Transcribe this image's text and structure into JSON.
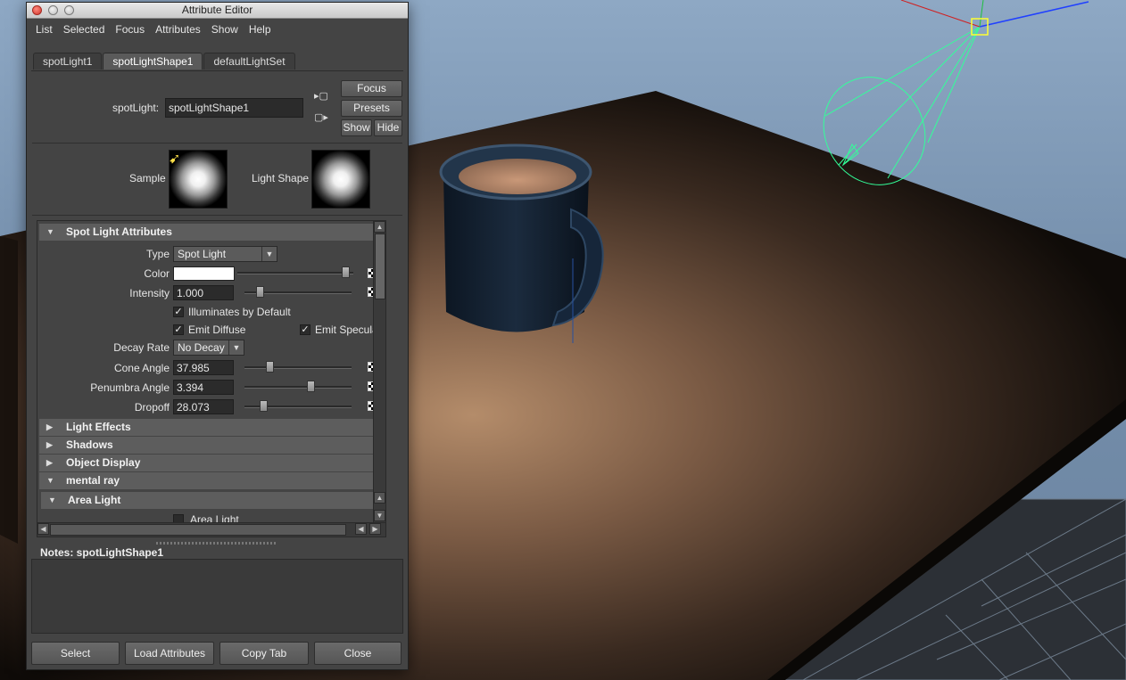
{
  "window": {
    "title": "Attribute Editor"
  },
  "menu": [
    "List",
    "Selected",
    "Focus",
    "Attributes",
    "Show",
    "Help"
  ],
  "tabs": [
    {
      "label": "spotLight1",
      "active": false
    },
    {
      "label": "spotLightShape1",
      "active": true
    },
    {
      "label": "defaultLightSet",
      "active": false
    }
  ],
  "header": {
    "node_type_label": "spotLight:",
    "node_name": "spotLightShape1",
    "focus": "Focus",
    "presets": "Presets",
    "show": "Show",
    "hide": "Hide"
  },
  "swatches": {
    "sample_label": "Sample",
    "light_shape_label": "Light Shape"
  },
  "spot_light": {
    "section_title": "Spot Light Attributes",
    "type_label": "Type",
    "type_value": "Spot Light",
    "color_label": "Color",
    "color_value": "#ffffff",
    "intensity_label": "Intensity",
    "intensity_value": "1.000",
    "illuminates_label": "Illuminates by Default",
    "illuminates_checked": true,
    "emit_diffuse_label": "Emit Diffuse",
    "emit_diffuse_checked": true,
    "emit_specular_label": "Emit Specular",
    "emit_specular_checked": true,
    "decay_label": "Decay Rate",
    "decay_value": "No Decay",
    "cone_label": "Cone Angle",
    "cone_value": "37.985",
    "penumbra_label": "Penumbra Angle",
    "penumbra_value": "3.394",
    "dropoff_label": "Dropoff",
    "dropoff_value": "28.073"
  },
  "sliders": {
    "color_level": 0.97,
    "intensity_level": 0.12,
    "cone_level": 0.22,
    "penumbra_level": 0.63,
    "dropoff_level": 0.15
  },
  "sections": {
    "light_effects": "Light Effects",
    "shadows": "Shadows",
    "object_display": "Object Display",
    "mental_ray": "mental ray",
    "area_light": "Area Light",
    "area_light_check": "Area Light"
  },
  "notes": {
    "label": "Notes:  spotLightShape1"
  },
  "footer": {
    "select": "Select",
    "load_attributes": "Load Attributes",
    "copy_tab": "Copy Tab",
    "close": "Close"
  },
  "colors": {
    "panel_bg": "#444444",
    "section_bg": "#5d5d5d",
    "light_gizmo": "#33ff99",
    "selection_box": "#ffff33",
    "viewport_sky": "#8ea8c4"
  }
}
